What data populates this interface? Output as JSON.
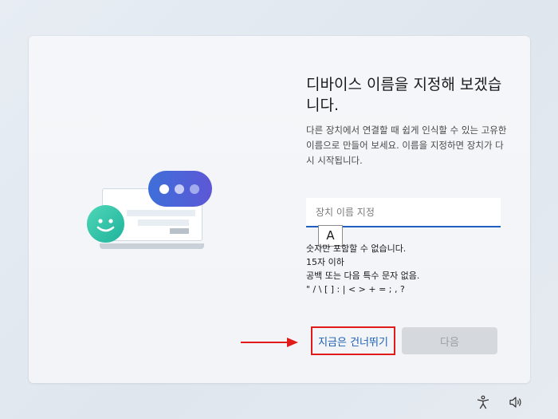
{
  "colors": {
    "accent": "#1f5fbf",
    "link": "#1a5fb4",
    "highlight_red": "#e11a1a",
    "bubble_start": "#3e6fd9",
    "bubble_end": "#5d57d6",
    "smile_green": "#1fb39b",
    "dot_colors": [
      "#ffffff",
      "#c8cdf5",
      "#a4abec"
    ]
  },
  "page": {
    "title": "디바이스 이름을 지정해 보겠습니다.",
    "description": "다른 장치에서 연결할 때 쉽게 인식할 수 있는 고유한 이름으로 만들어 보세요. 이름을 지정하면 장치가 다시 시작됩니다."
  },
  "name_input": {
    "value": "",
    "placeholder": "장치 이름 지정"
  },
  "ime_indicator": "A",
  "rules": [
    "숫자만 포함할 수 없습니다.",
    "15자 이하",
    "공백 또는 다음 특수 문자 없음.",
    "\" / \\ [ ] : | < > + = ; , ?"
  ],
  "buttons": {
    "skip": "지금은 건너뛰기",
    "next": "다음"
  },
  "icons": {
    "cursor": "mouse-pointer-icon",
    "accessibility": "accessibility-icon",
    "volume": "volume-icon"
  }
}
